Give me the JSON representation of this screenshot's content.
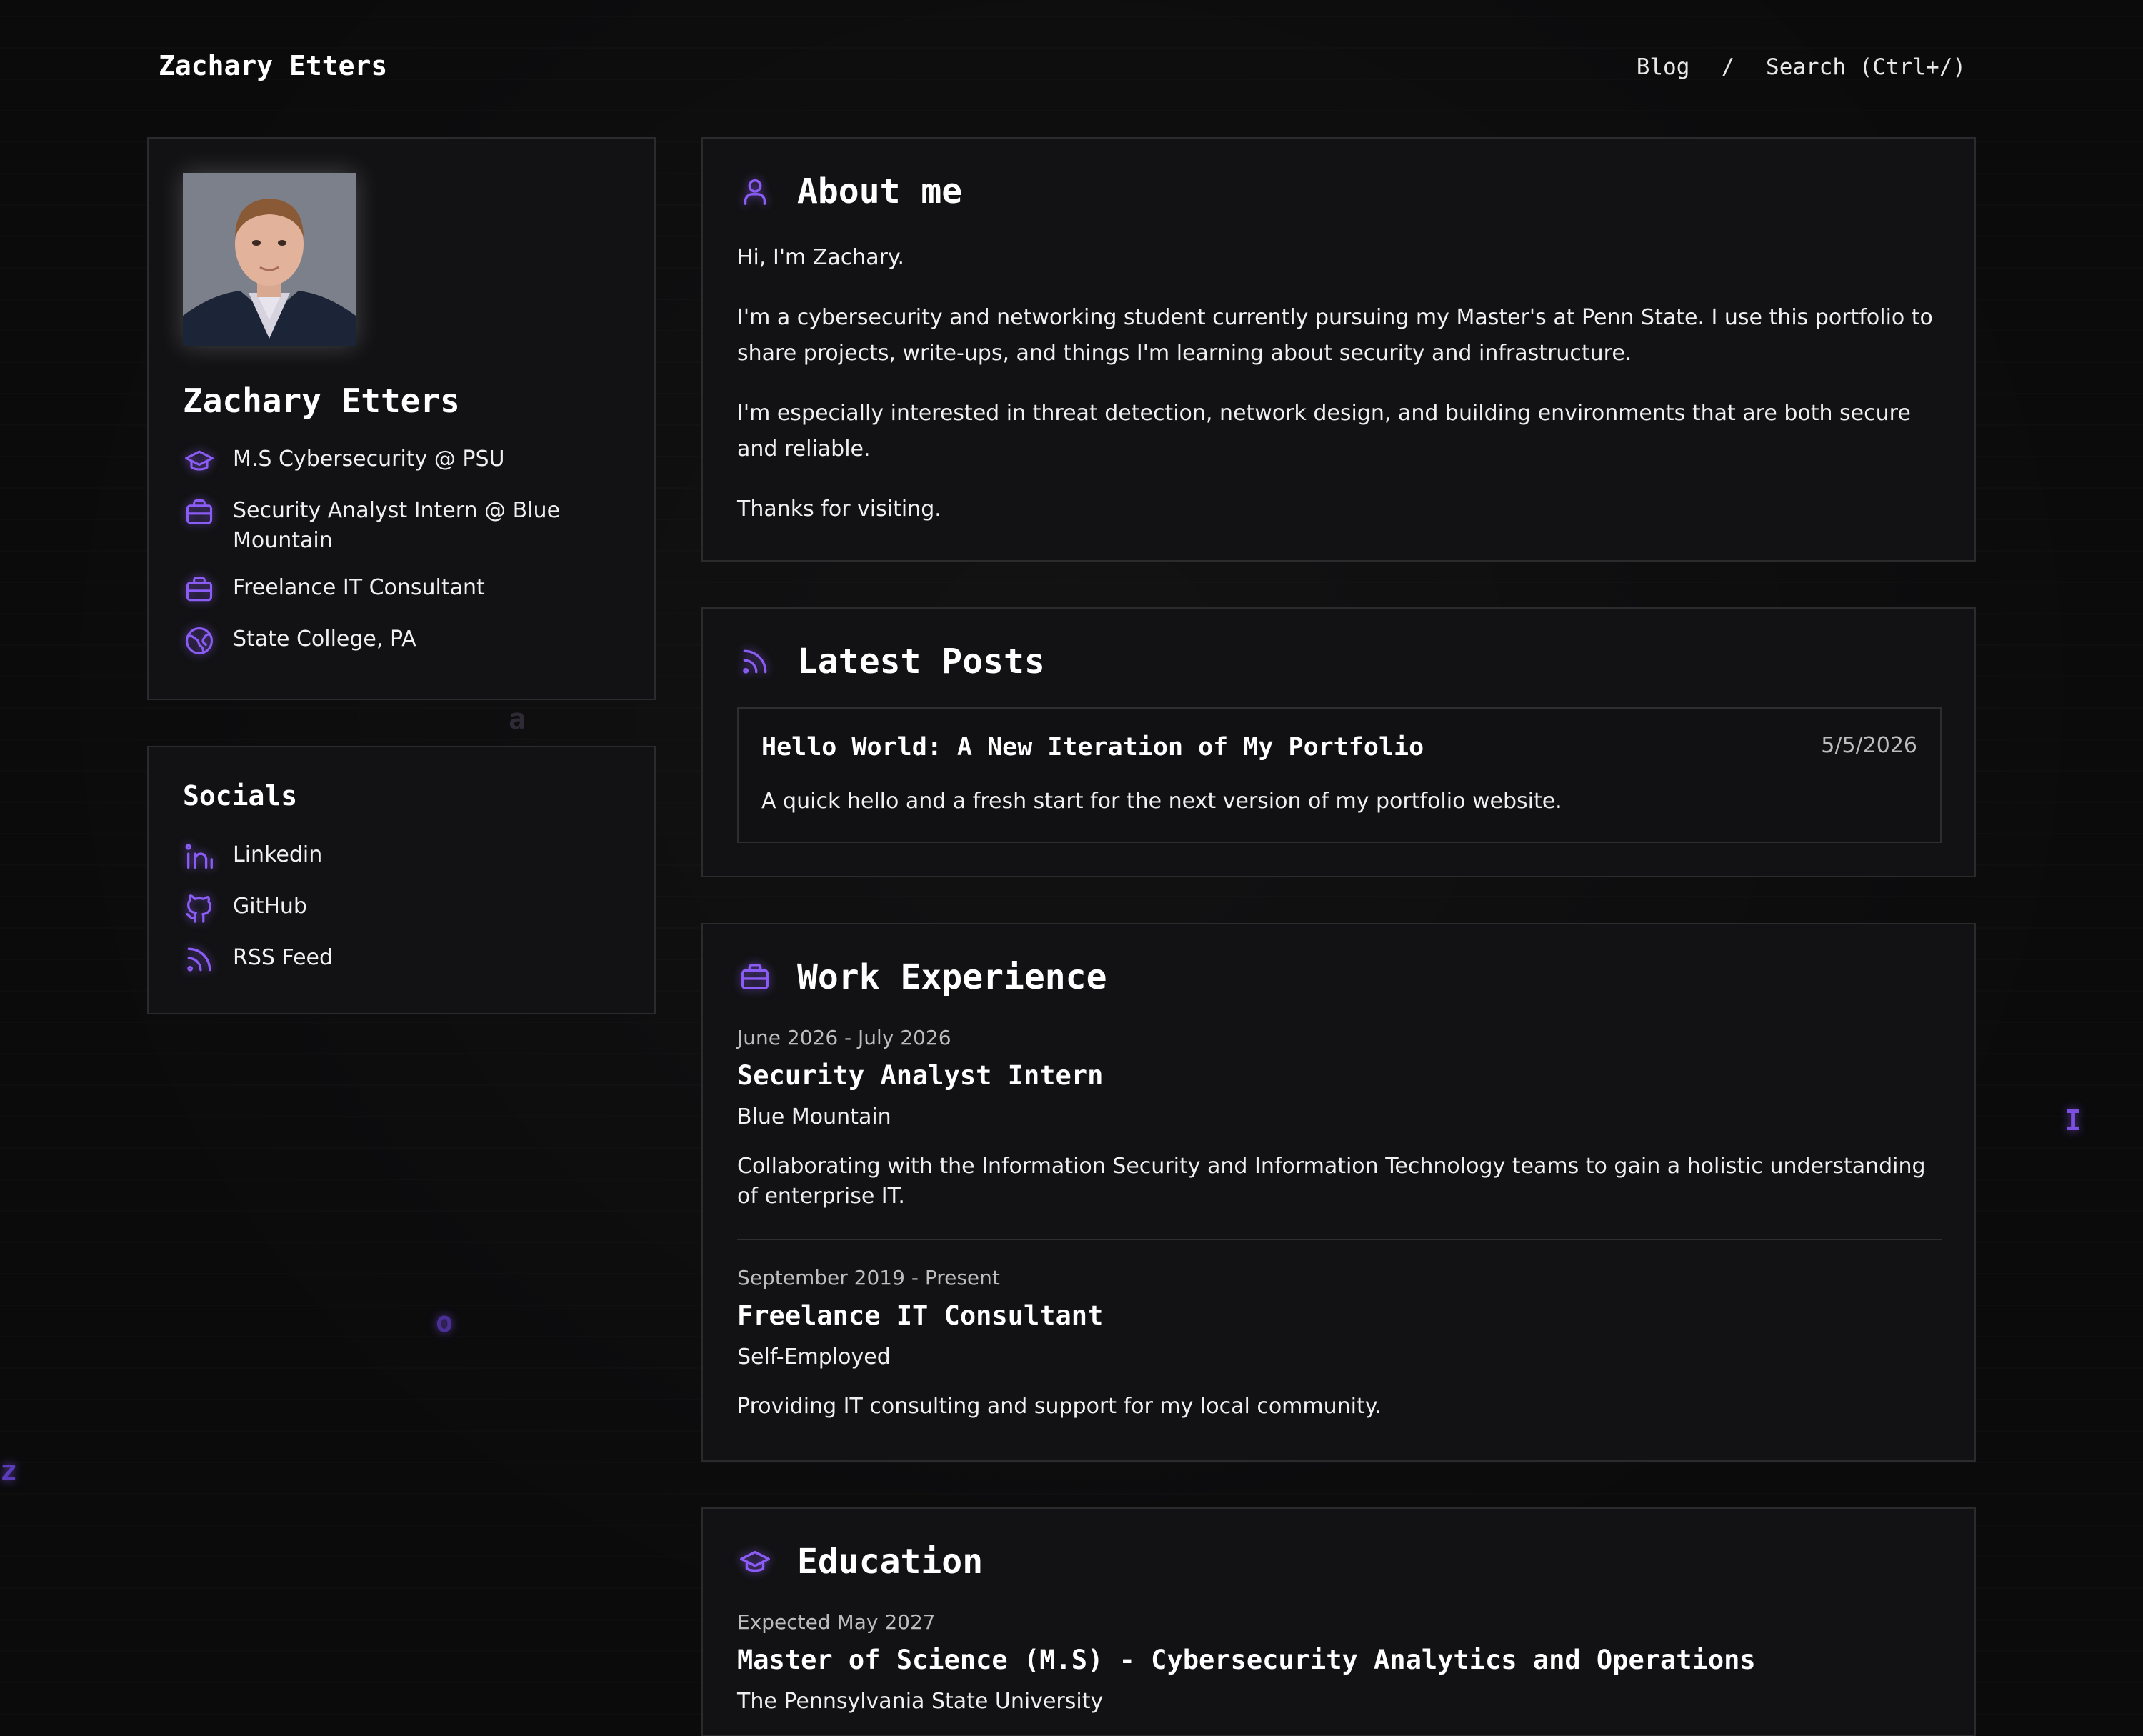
{
  "header": {
    "site_title": "Zachary Etters",
    "nav": {
      "blog": "Blog",
      "separator": "/",
      "search": "Search (Ctrl+/)"
    }
  },
  "background_letters": [
    "a",
    "o",
    "z",
    "I"
  ],
  "colors": {
    "accent": "#8b5cf6",
    "background": "#0b0b0c",
    "card": "#121214",
    "border": "#2b2b2e"
  },
  "profile": {
    "name": "Zachary Etters",
    "items": [
      {
        "icon": "graduation-cap-icon",
        "text": "M.S Cybersecurity @ PSU"
      },
      {
        "icon": "briefcase-icon",
        "text": "Security Analyst Intern @ Blue Mountain"
      },
      {
        "icon": "briefcase-icon",
        "text": "Freelance IT Consultant"
      },
      {
        "icon": "globe-icon",
        "text": "State College, PA"
      }
    ]
  },
  "socials": {
    "title": "Socials",
    "items": [
      {
        "icon": "linkedin-icon",
        "label": "Linkedin"
      },
      {
        "icon": "github-icon",
        "label": "GitHub"
      },
      {
        "icon": "rss-icon",
        "label": "RSS Feed"
      }
    ]
  },
  "about": {
    "title": "About me",
    "paragraphs": [
      "Hi, I'm Zachary.",
      "I'm a cybersecurity and networking student currently pursuing my Master's at Penn State. I use this portfolio to share projects, write-ups, and things I'm learning about security and infrastructure.",
      "I'm especially interested in threat detection, network design, and building environments that are both secure and reliable.",
      "Thanks for visiting."
    ]
  },
  "posts": {
    "title": "Latest Posts",
    "items": [
      {
        "title": "Hello World: A New Iteration of My Portfolio",
        "date": "5/5/2026",
        "description": "A quick hello and a fresh start for the next version of my portfolio website."
      }
    ]
  },
  "work": {
    "title": "Work Experience",
    "jobs": [
      {
        "dates": "June 2026 - July 2026",
        "title": "Security Analyst Intern",
        "org": "Blue Mountain",
        "description": "Collaborating with the Information Security and Information Technology teams to gain a holistic understanding of enterprise IT."
      },
      {
        "dates": "September 2019 - Present",
        "title": "Freelance IT Consultant",
        "org": "Self-Employed",
        "description": "Providing IT consulting and support for my local community."
      }
    ]
  },
  "education": {
    "title": "Education",
    "items": [
      {
        "dates": "Expected May 2027",
        "degree": "Master of Science (M.S) - Cybersecurity Analytics and Operations",
        "school": "The Pennsylvania State University"
      }
    ]
  }
}
